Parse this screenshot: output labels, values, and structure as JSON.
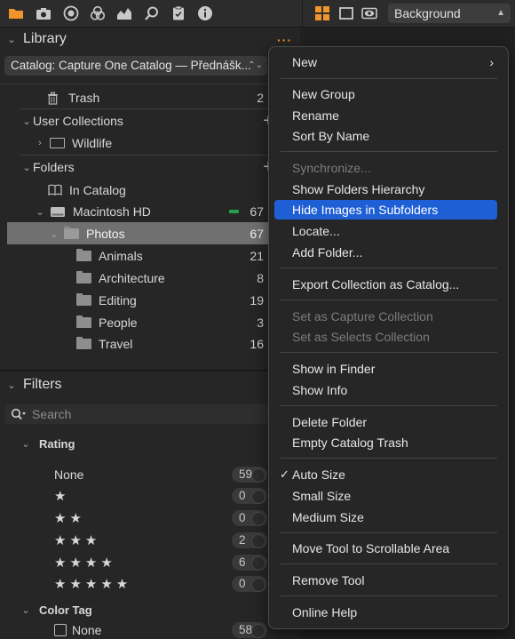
{
  "toolbar": {
    "left_icons": [
      "folder-icon",
      "camera-icon",
      "lens-icon",
      "color-balance-icon",
      "histogram-icon",
      "search-icon",
      "clipboard-icon",
      "info-icon"
    ],
    "right_icons": [
      "grid-view-icon",
      "single-view-icon",
      "eye-icon"
    ],
    "background_select": "Background",
    "accent_color": "#f0952b"
  },
  "library": {
    "title": "Library",
    "more_icon": "more-dots-icon",
    "catalog": "Catalog: Capture One Catalog — Přednášk...",
    "trash": {
      "label": "Trash",
      "count": "2"
    },
    "user_collections": {
      "label": "User Collections",
      "items": [
        {
          "label": "Wildlife"
        }
      ]
    },
    "folders": {
      "label": "Folders",
      "in_catalog": "In Catalog",
      "volume": {
        "label": "Macintosh HD",
        "count": "67"
      },
      "photos": {
        "label": "Photos",
        "count": "67"
      },
      "subfolders": [
        {
          "label": "Animals",
          "count": "21"
        },
        {
          "label": "Architecture",
          "count": "8"
        },
        {
          "label": "Editing",
          "count": "19"
        },
        {
          "label": "People",
          "count": "3"
        },
        {
          "label": "Travel",
          "count": "16"
        }
      ]
    }
  },
  "filters": {
    "title": "Filters",
    "search_placeholder": "Search",
    "rating": {
      "label": "Rating",
      "rows": [
        {
          "label": "None",
          "count": "59"
        },
        {
          "label": "★",
          "count": "0"
        },
        {
          "label": "★★",
          "count": "0"
        },
        {
          "label": "★★★",
          "count": "2"
        },
        {
          "label": "★★★★",
          "count": "6"
        },
        {
          "label": "★★★★★",
          "count": "0"
        }
      ]
    },
    "color_tag": {
      "label": "Color Tag",
      "none_label": "None",
      "none_count": "58"
    }
  },
  "menu": {
    "items": [
      {
        "label": "New",
        "submenu": true
      },
      {
        "label": "New Group"
      },
      {
        "label": "Rename"
      },
      {
        "label": "Sort By Name"
      },
      {
        "label": "Synchronize...",
        "disabled": true
      },
      {
        "label": "Show Folders Hierarchy"
      },
      {
        "label": "Hide Images in Subfolders",
        "active": true
      },
      {
        "label": "Locate..."
      },
      {
        "label": "Add Folder..."
      },
      {
        "label": "Export Collection as Catalog..."
      },
      {
        "label": "Set as Capture Collection",
        "disabled": true
      },
      {
        "label": "Set as Selects Collection",
        "disabled": true
      },
      {
        "label": "Show in Finder"
      },
      {
        "label": "Show Info"
      },
      {
        "label": "Delete Folder"
      },
      {
        "label": "Empty Catalog Trash"
      },
      {
        "label": "Auto Size",
        "checked": true
      },
      {
        "label": "Small Size"
      },
      {
        "label": "Medium Size"
      },
      {
        "label": "Move Tool to Scrollable Area"
      },
      {
        "label": "Remove Tool"
      },
      {
        "label": "Online Help"
      }
    ],
    "submenu_arrow": "›",
    "checkmark": "✓",
    "active_color": "#1f5fd6"
  }
}
